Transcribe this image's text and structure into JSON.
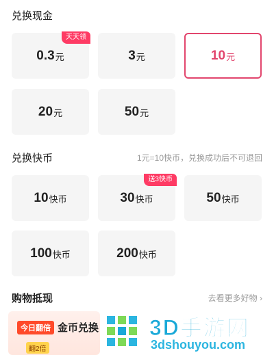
{
  "cash": {
    "title": "兑换现金",
    "items": [
      {
        "amount": "0.3",
        "unit": "元",
        "tag": "天天领"
      },
      {
        "amount": "3",
        "unit": "元"
      },
      {
        "amount": "10",
        "unit": "元",
        "selected": true
      },
      {
        "amount": "20",
        "unit": "元"
      },
      {
        "amount": "50",
        "unit": "元"
      }
    ]
  },
  "coins": {
    "title": "兑换快币",
    "note": "1元=10快币，兑换成功后不可退回",
    "items": [
      {
        "amount": "10",
        "unit": "快币"
      },
      {
        "amount": "30",
        "unit": "快币",
        "tag": "送3快币"
      },
      {
        "amount": "50",
        "unit": "快币"
      },
      {
        "amount": "100",
        "unit": "快币"
      },
      {
        "amount": "200",
        "unit": "快币"
      }
    ]
  },
  "shopping": {
    "title": "购物抵现",
    "more_label": "去看更多好物 ›",
    "banner": {
      "badge": "今日翻倍",
      "text": "金币兑换",
      "small_badge": "翻2倍"
    }
  },
  "watermark": {
    "title": "3D手游网",
    "url": "3dshouyou.com"
  },
  "colors": {
    "accent": "#e2456d",
    "tag_bg": "#fe3b64",
    "card_bg": "#f5f5f5",
    "watermark": "#1aa9d8"
  }
}
